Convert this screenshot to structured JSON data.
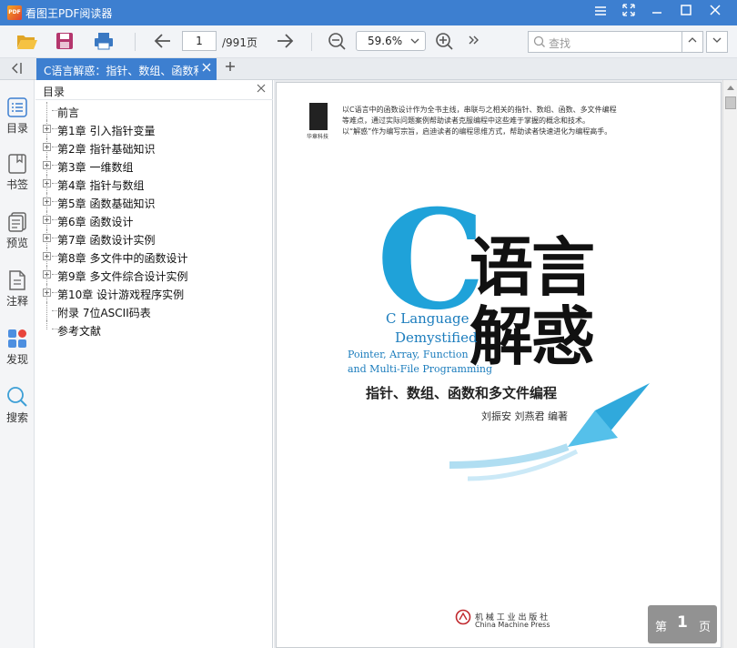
{
  "app": {
    "title": "看图王PDF阅读器",
    "logo_text": "PDF"
  },
  "toolbar": {
    "page_current": "1",
    "page_total": "/991页",
    "zoom": "59.6%",
    "search_placeholder": "查找"
  },
  "tabs": [
    {
      "label": "C语言解惑：指针、数组、函数和"
    }
  ],
  "rail": [
    {
      "label": "目录",
      "icon": "list-icon"
    },
    {
      "label": "书签",
      "icon": "bookmark-icon"
    },
    {
      "label": "预览",
      "icon": "preview-icon"
    },
    {
      "label": "注释",
      "icon": "note-icon"
    },
    {
      "label": "发现",
      "icon": "discover-icon"
    },
    {
      "label": "搜索",
      "icon": "search-icon"
    }
  ],
  "outline": {
    "title": "目录",
    "items": [
      {
        "label": "前言",
        "expandable": false
      },
      {
        "label": "第1章 引入指针变量",
        "expandable": true
      },
      {
        "label": "第2章 指针基础知识",
        "expandable": true
      },
      {
        "label": "第3章 一维数组",
        "expandable": true
      },
      {
        "label": "第4章 指针与数组",
        "expandable": true
      },
      {
        "label": "第5章 函数基础知识",
        "expandable": true
      },
      {
        "label": "第6章 函数设计",
        "expandable": true
      },
      {
        "label": "第7章 函数设计实例",
        "expandable": true
      },
      {
        "label": "第8章 多文件中的函数设计",
        "expandable": true
      },
      {
        "label": "第9章 多文件综合设计实例",
        "expandable": true
      },
      {
        "label": "第10章 设计游戏程序实例",
        "expandable": true
      },
      {
        "label": "附录 7位ASCII码表",
        "expandable": false
      },
      {
        "label": "参考文献",
        "expandable": false
      }
    ]
  },
  "cover": {
    "publisher_logo_text": "华章科技",
    "intro_line1": "以C语言中的函数设计作为全书主线，串联与之相关的指针、数组、函数、多文件编程",
    "intro_line2": "等难点，通过实际问题案例帮助读者克服编程中这些难于掌握的概念和技术。",
    "intro_line3": "以“解惑”作为编写宗旨，启迪读者的编程思维方式，帮助读者快速进化为编程高手。",
    "big_letter": "C",
    "title_line1": "语言",
    "title_line2": "解惑",
    "en_line1": "C Language",
    "en_line2": "Demystified",
    "en_line3": "Pointer, Array, Function",
    "en_line4": "and Multi-File Programming",
    "subtitle": "指针、数组、函数和多文件编程",
    "authors": "刘振安 刘燕君 编著",
    "press_cn": "机 械 工 业 出 版 社",
    "press_en": "China Machine Press"
  },
  "page_badge": {
    "prefix": "第",
    "number": "1",
    "suffix": "页"
  },
  "colors": {
    "accent": "#3d7fd0",
    "cover_blue": "#1fa2d9"
  }
}
